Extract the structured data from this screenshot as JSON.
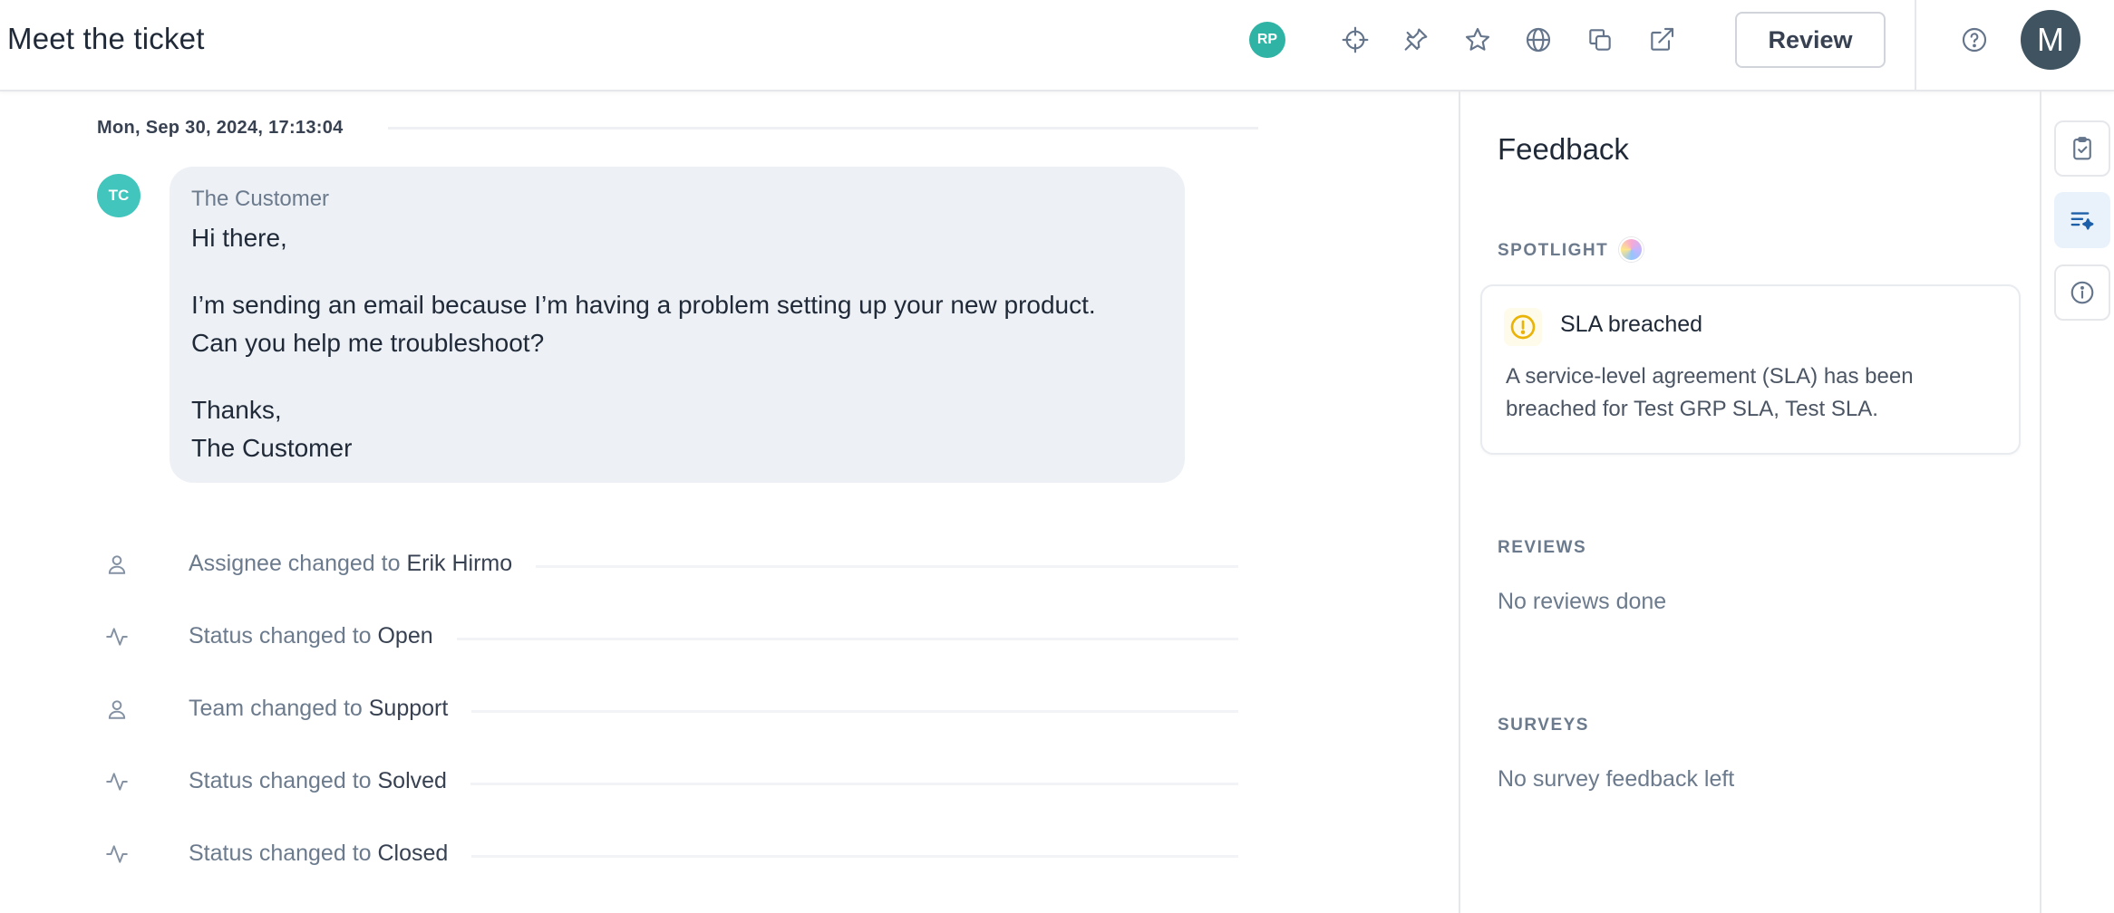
{
  "header": {
    "title": "Meet the ticket",
    "assignee_initials": "RP",
    "review_label": "Review",
    "user_initial": "M",
    "icons": [
      "crosshair-icon",
      "pin-icon",
      "star-icon",
      "globe-icon",
      "copy-icon",
      "external-link-icon",
      "help-icon"
    ]
  },
  "conversation": {
    "timestamp": "Mon, Sep 30, 2024, 17:13:04",
    "message": {
      "avatar_initials": "TC",
      "sender": "The Customer",
      "greeting": "Hi there,",
      "body_line1": "I’m sending an email because I’m having a problem setting up your new product.",
      "body_line2": "Can you help me troubleshoot?",
      "signoff": "Thanks,",
      "signature": "The Customer"
    },
    "events": [
      {
        "icon": "person-icon",
        "text": "Assignee changed to ",
        "value": "Erik Hirmo"
      },
      {
        "icon": "activity-icon",
        "text": "Status changed to ",
        "value": "Open"
      },
      {
        "icon": "person-icon",
        "text": "Team changed to ",
        "value": "Support"
      },
      {
        "icon": "activity-icon",
        "text": "Status changed to ",
        "value": "Solved"
      },
      {
        "icon": "activity-icon",
        "text": "Status changed to ",
        "value": "Closed"
      }
    ]
  },
  "feedback": {
    "title": "Feedback",
    "spotlight_label": "SPOTLIGHT",
    "sla_card": {
      "title": "SLA breached",
      "description": "A service-level agreement (SLA) has been breached for Test GRP SLA, Test SLA."
    },
    "reviews_label": "REVIEWS",
    "reviews_empty": "No reviews done",
    "surveys_label": "SURVEYS",
    "surveys_empty": "No survey feedback left"
  },
  "colors": {
    "accent_teal": "#2fb3a4",
    "customer_avatar": "#41c5bc",
    "bubble_bg": "#edf1f6",
    "user_avatar": "#3f5361",
    "warning": "#eab308",
    "active_rail": "#1d5fa8"
  }
}
